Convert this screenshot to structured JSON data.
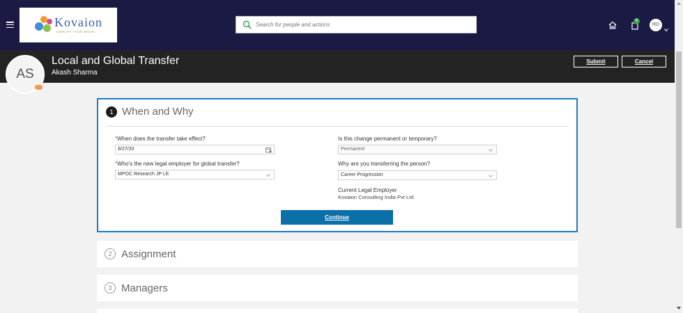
{
  "topbar": {
    "logo": {
      "word": "Kovaion",
      "tagline": "SIMPLIFY YOUR NEEDS"
    },
    "search": {
      "placeholder": "Search for people and actions"
    },
    "notifications": {
      "count": "6"
    },
    "user": {
      "initials": "RD"
    }
  },
  "header": {
    "title": "Local and Global Transfer",
    "person_name": "Akash Sharma",
    "avatar_initials": "AS",
    "submit_label": "Submit",
    "cancel_label": "Cancel"
  },
  "steps": [
    {
      "number": "1",
      "title": "When and Why"
    },
    {
      "number": "2",
      "title": "Assignment"
    },
    {
      "number": "3",
      "title": "Managers"
    }
  ],
  "form": {
    "required_marker": "*",
    "effective_date": {
      "label": "When does the transfer take effect?",
      "value": "8/27/20"
    },
    "legal_employer": {
      "label": "Who's the new legal employer for global transfer?",
      "value": "MPOC Research JP LE"
    },
    "change_type": {
      "label": "Is this change permanent or temporary?",
      "value": "Permanent"
    },
    "reason": {
      "label": "Why are you transferring the person?",
      "value": "Career Progression"
    },
    "current_employer": {
      "label": "Current Legal Employer",
      "value": "Kovaion Consulting India Pvt Ltd"
    },
    "continue_label": "Continue"
  },
  "colors": {
    "topbar": "#1b1a45",
    "header": "#232323",
    "accent": "#1b7bc0",
    "continue_button": "#0b6fa8",
    "badge": "#37a34a"
  },
  "icons": [
    "menu-icon",
    "search-icon",
    "home-icon",
    "notification-icon",
    "chevron-down-icon",
    "calendar-icon"
  ]
}
